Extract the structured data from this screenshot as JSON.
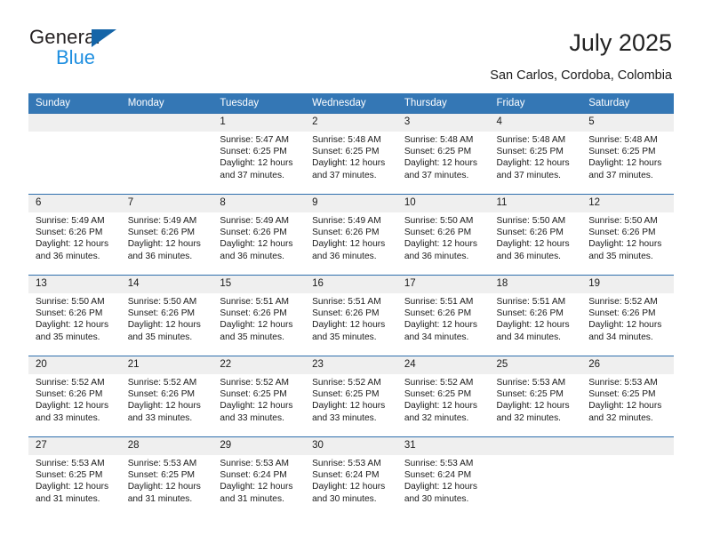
{
  "logo": {
    "primary_text": "General",
    "secondary_text": "Blue",
    "triangle_color": "#1565a8",
    "secondary_color": "#1f8fe0"
  },
  "header": {
    "title": "July 2025",
    "subtitle": "San Carlos, Cordoba, Colombia"
  },
  "theme": {
    "header_row_bg": "#3477b5",
    "row_divider": "#2f6fad",
    "daynum_bg": "#efefef",
    "text": "#1a1a1a"
  },
  "calendar": {
    "weekday_headers": [
      "Sunday",
      "Monday",
      "Tuesday",
      "Wednesday",
      "Thursday",
      "Friday",
      "Saturday"
    ],
    "labels": {
      "sunrise": "Sunrise:",
      "sunset": "Sunset:",
      "daylight": "Daylight:"
    },
    "weeks": [
      [
        {
          "day": "",
          "empty": true,
          "sunrise": "",
          "sunset": "",
          "daylight_1": "",
          "daylight_2": ""
        },
        {
          "day": "",
          "empty": true,
          "sunrise": "",
          "sunset": "",
          "daylight_1": "",
          "daylight_2": ""
        },
        {
          "day": "1",
          "sunrise": "Sunrise: 5:47 AM",
          "sunset": "Sunset: 6:25 PM",
          "daylight_1": "Daylight: 12 hours",
          "daylight_2": "and 37 minutes."
        },
        {
          "day": "2",
          "sunrise": "Sunrise: 5:48 AM",
          "sunset": "Sunset: 6:25 PM",
          "daylight_1": "Daylight: 12 hours",
          "daylight_2": "and 37 minutes."
        },
        {
          "day": "3",
          "sunrise": "Sunrise: 5:48 AM",
          "sunset": "Sunset: 6:25 PM",
          "daylight_1": "Daylight: 12 hours",
          "daylight_2": "and 37 minutes."
        },
        {
          "day": "4",
          "sunrise": "Sunrise: 5:48 AM",
          "sunset": "Sunset: 6:25 PM",
          "daylight_1": "Daylight: 12 hours",
          "daylight_2": "and 37 minutes."
        },
        {
          "day": "5",
          "sunrise": "Sunrise: 5:48 AM",
          "sunset": "Sunset: 6:25 PM",
          "daylight_1": "Daylight: 12 hours",
          "daylight_2": "and 37 minutes."
        }
      ],
      [
        {
          "day": "6",
          "sunrise": "Sunrise: 5:49 AM",
          "sunset": "Sunset: 6:26 PM",
          "daylight_1": "Daylight: 12 hours",
          "daylight_2": "and 36 minutes."
        },
        {
          "day": "7",
          "sunrise": "Sunrise: 5:49 AM",
          "sunset": "Sunset: 6:26 PM",
          "daylight_1": "Daylight: 12 hours",
          "daylight_2": "and 36 minutes."
        },
        {
          "day": "8",
          "sunrise": "Sunrise: 5:49 AM",
          "sunset": "Sunset: 6:26 PM",
          "daylight_1": "Daylight: 12 hours",
          "daylight_2": "and 36 minutes."
        },
        {
          "day": "9",
          "sunrise": "Sunrise: 5:49 AM",
          "sunset": "Sunset: 6:26 PM",
          "daylight_1": "Daylight: 12 hours",
          "daylight_2": "and 36 minutes."
        },
        {
          "day": "10",
          "sunrise": "Sunrise: 5:50 AM",
          "sunset": "Sunset: 6:26 PM",
          "daylight_1": "Daylight: 12 hours",
          "daylight_2": "and 36 minutes."
        },
        {
          "day": "11",
          "sunrise": "Sunrise: 5:50 AM",
          "sunset": "Sunset: 6:26 PM",
          "daylight_1": "Daylight: 12 hours",
          "daylight_2": "and 36 minutes."
        },
        {
          "day": "12",
          "sunrise": "Sunrise: 5:50 AM",
          "sunset": "Sunset: 6:26 PM",
          "daylight_1": "Daylight: 12 hours",
          "daylight_2": "and 35 minutes."
        }
      ],
      [
        {
          "day": "13",
          "sunrise": "Sunrise: 5:50 AM",
          "sunset": "Sunset: 6:26 PM",
          "daylight_1": "Daylight: 12 hours",
          "daylight_2": "and 35 minutes."
        },
        {
          "day": "14",
          "sunrise": "Sunrise: 5:50 AM",
          "sunset": "Sunset: 6:26 PM",
          "daylight_1": "Daylight: 12 hours",
          "daylight_2": "and 35 minutes."
        },
        {
          "day": "15",
          "sunrise": "Sunrise: 5:51 AM",
          "sunset": "Sunset: 6:26 PM",
          "daylight_1": "Daylight: 12 hours",
          "daylight_2": "and 35 minutes."
        },
        {
          "day": "16",
          "sunrise": "Sunrise: 5:51 AM",
          "sunset": "Sunset: 6:26 PM",
          "daylight_1": "Daylight: 12 hours",
          "daylight_2": "and 35 minutes."
        },
        {
          "day": "17",
          "sunrise": "Sunrise: 5:51 AM",
          "sunset": "Sunset: 6:26 PM",
          "daylight_1": "Daylight: 12 hours",
          "daylight_2": "and 34 minutes."
        },
        {
          "day": "18",
          "sunrise": "Sunrise: 5:51 AM",
          "sunset": "Sunset: 6:26 PM",
          "daylight_1": "Daylight: 12 hours",
          "daylight_2": "and 34 minutes."
        },
        {
          "day": "19",
          "sunrise": "Sunrise: 5:52 AM",
          "sunset": "Sunset: 6:26 PM",
          "daylight_1": "Daylight: 12 hours",
          "daylight_2": "and 34 minutes."
        }
      ],
      [
        {
          "day": "20",
          "sunrise": "Sunrise: 5:52 AM",
          "sunset": "Sunset: 6:26 PM",
          "daylight_1": "Daylight: 12 hours",
          "daylight_2": "and 33 minutes."
        },
        {
          "day": "21",
          "sunrise": "Sunrise: 5:52 AM",
          "sunset": "Sunset: 6:26 PM",
          "daylight_1": "Daylight: 12 hours",
          "daylight_2": "and 33 minutes."
        },
        {
          "day": "22",
          "sunrise": "Sunrise: 5:52 AM",
          "sunset": "Sunset: 6:25 PM",
          "daylight_1": "Daylight: 12 hours",
          "daylight_2": "and 33 minutes."
        },
        {
          "day": "23",
          "sunrise": "Sunrise: 5:52 AM",
          "sunset": "Sunset: 6:25 PM",
          "daylight_1": "Daylight: 12 hours",
          "daylight_2": "and 33 minutes."
        },
        {
          "day": "24",
          "sunrise": "Sunrise: 5:52 AM",
          "sunset": "Sunset: 6:25 PM",
          "daylight_1": "Daylight: 12 hours",
          "daylight_2": "and 32 minutes."
        },
        {
          "day": "25",
          "sunrise": "Sunrise: 5:53 AM",
          "sunset": "Sunset: 6:25 PM",
          "daylight_1": "Daylight: 12 hours",
          "daylight_2": "and 32 minutes."
        },
        {
          "day": "26",
          "sunrise": "Sunrise: 5:53 AM",
          "sunset": "Sunset: 6:25 PM",
          "daylight_1": "Daylight: 12 hours",
          "daylight_2": "and 32 minutes."
        }
      ],
      [
        {
          "day": "27",
          "sunrise": "Sunrise: 5:53 AM",
          "sunset": "Sunset: 6:25 PM",
          "daylight_1": "Daylight: 12 hours",
          "daylight_2": "and 31 minutes."
        },
        {
          "day": "28",
          "sunrise": "Sunrise: 5:53 AM",
          "sunset": "Sunset: 6:25 PM",
          "daylight_1": "Daylight: 12 hours",
          "daylight_2": "and 31 minutes."
        },
        {
          "day": "29",
          "sunrise": "Sunrise: 5:53 AM",
          "sunset": "Sunset: 6:24 PM",
          "daylight_1": "Daylight: 12 hours",
          "daylight_2": "and 31 minutes."
        },
        {
          "day": "30",
          "sunrise": "Sunrise: 5:53 AM",
          "sunset": "Sunset: 6:24 PM",
          "daylight_1": "Daylight: 12 hours",
          "daylight_2": "and 30 minutes."
        },
        {
          "day": "31",
          "sunrise": "Sunrise: 5:53 AM",
          "sunset": "Sunset: 6:24 PM",
          "daylight_1": "Daylight: 12 hours",
          "daylight_2": "and 30 minutes."
        },
        {
          "day": "",
          "empty": true,
          "sunrise": "",
          "sunset": "",
          "daylight_1": "",
          "daylight_2": ""
        },
        {
          "day": "",
          "empty": true,
          "sunrise": "",
          "sunset": "",
          "daylight_1": "",
          "daylight_2": ""
        }
      ]
    ]
  }
}
